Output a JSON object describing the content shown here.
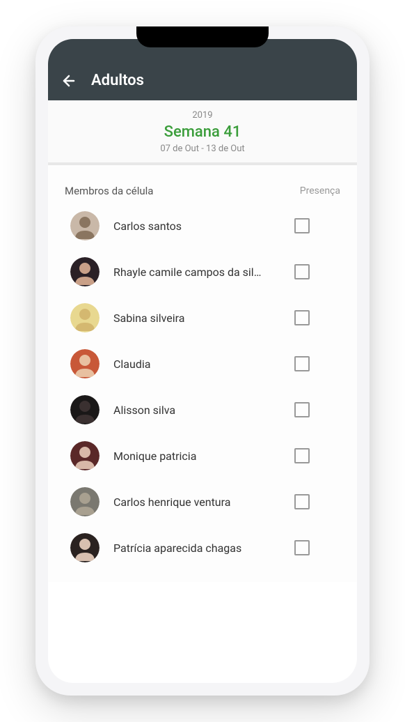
{
  "header": {
    "title": "Adultos"
  },
  "week": {
    "year": "2019",
    "title": "Semana 41",
    "range": "07 de Out - 13 de Out"
  },
  "list": {
    "members_label": "Membros da célula",
    "presence_label": "Presença"
  },
  "members": [
    {
      "name": "Carlos santos",
      "avatar_bg": "#c9b8a8",
      "avatar_fg": "#8a7560"
    },
    {
      "name": "Rhayle camile campos da sil…",
      "avatar_bg": "#2a2026",
      "avatar_fg": "#c9a088"
    },
    {
      "name": "Sabina silveira",
      "avatar_bg": "#e8d890",
      "avatar_fg": "#d4b870"
    },
    {
      "name": "Claudia",
      "avatar_bg": "#c85838",
      "avatar_fg": "#e8c0a0"
    },
    {
      "name": "Alisson silva",
      "avatar_bg": "#1a1818",
      "avatar_fg": "#3a3030"
    },
    {
      "name": "Monique patricia",
      "avatar_bg": "#5a2828",
      "avatar_fg": "#d8b8a8"
    },
    {
      "name": "Carlos henrique ventura",
      "avatar_bg": "#7a7870",
      "avatar_fg": "#a8a090"
    },
    {
      "name": "Patrícia aparecida chagas",
      "avatar_bg": "#2a2220",
      "avatar_fg": "#d8c0b0"
    }
  ]
}
